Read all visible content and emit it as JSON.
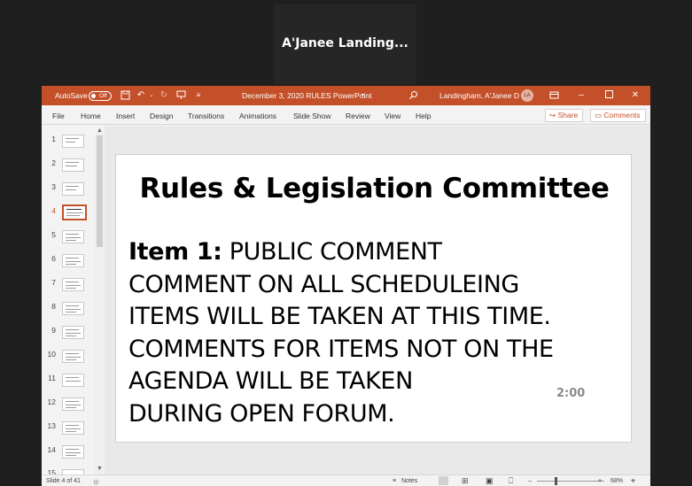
{
  "meeting": {
    "participant_name": "A'Janee  Landing..."
  },
  "titlebar": {
    "autosave_label": "AutoSave",
    "autosave_state": "Off",
    "document_title": "December 3, 2020 RULES PowerPoint",
    "user_name": "Landingham, A'Janee D",
    "user_initials": "LA"
  },
  "menu": {
    "items": [
      "File",
      "Home",
      "Insert",
      "Design",
      "Transitions",
      "Animations",
      "Slide Show",
      "Review",
      "View",
      "Help"
    ],
    "share_label": "Share",
    "comments_label": "Comments"
  },
  "thumbnails": {
    "numbers": [
      "1",
      "2",
      "3",
      "4",
      "5",
      "6",
      "7",
      "8",
      "9",
      "10",
      "11",
      "12",
      "13",
      "14",
      "15"
    ],
    "selected_index": 4
  },
  "slide": {
    "title": "Rules & Legislation Committee",
    "item_label": "Item 1:",
    "body_first_line": " PUBLIC COMMENT",
    "body_lines": [
      "COMMENT ON ALL SCHEDULEING",
      "ITEMS WILL BE TAKEN AT THIS TIME.",
      "COMMENTS FOR ITEMS NOT ON THE",
      "AGENDA WILL BE TAKEN",
      "DURING OPEN FORUM."
    ],
    "timer": "2:00"
  },
  "statusbar": {
    "slide_counter": "Slide 4 of 41",
    "notes_label": "Notes",
    "zoom_minus": "–",
    "zoom_plus": "+",
    "zoom_level": "68%"
  },
  "colors": {
    "accent": "#c4502a",
    "background": "#1f1f1f"
  }
}
